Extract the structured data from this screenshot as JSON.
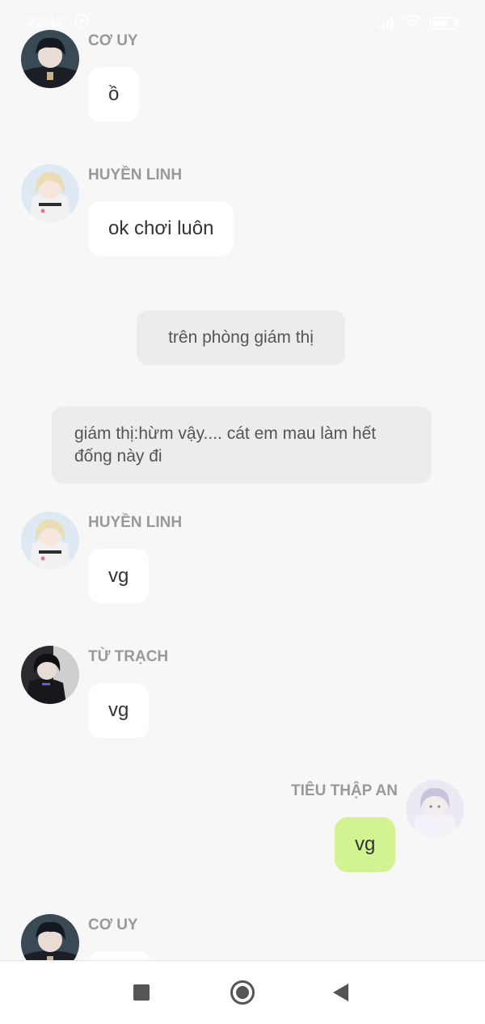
{
  "status_bar": {
    "time": "22:42"
  },
  "messages": [
    {
      "sender": "CƠ UY",
      "text": "ồ"
    },
    {
      "sender": "HUYỀN LINH",
      "text": "ok chơi luôn"
    },
    {
      "narration": "trên phòng giám thị"
    },
    {
      "narration": "giám thị:hừm vậy.... cát em mau làm hết đống này đi"
    },
    {
      "sender": "HUYỀN LINH",
      "text": "vg"
    },
    {
      "sender": "TỪ TRẠCH",
      "text": "vg"
    },
    {
      "sender": "TIÊU THẬP AN",
      "text": "vg",
      "self": true
    },
    {
      "sender": "CƠ UY",
      "text": ""
    }
  ],
  "nav": {
    "recents_icon": "square-icon",
    "home_icon": "circle-icon",
    "back_icon": "triangle-back-icon"
  },
  "colors": {
    "background": "#f7f7f7",
    "bubble_other": "#ffffff",
    "bubble_self": "#d3f292",
    "narration_bg": "#ececec",
    "sender_name": "#999999"
  }
}
